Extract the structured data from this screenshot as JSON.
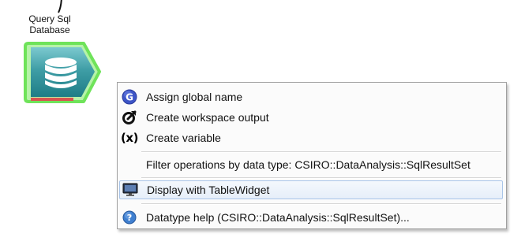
{
  "canvas": {
    "node": {
      "label_line1": "Query Sql",
      "label_line2": "Database",
      "icon": "database-icon",
      "border_color": "#7ee86a",
      "fill_color": "#2f8f97",
      "status_bar_color": "#d9534f"
    }
  },
  "context_menu": {
    "items": [
      {
        "label": "Assign global name",
        "icon": "global-name-icon"
      },
      {
        "label": "Create workspace output",
        "icon": "workspace-output-icon"
      },
      {
        "label": "Create variable",
        "icon": "variable-icon"
      },
      {
        "label": "Filter operations by data type: CSIRO::DataAnalysis::SqlResultSet",
        "icon": ""
      },
      {
        "label": "Display with TableWidget",
        "icon": "monitor-icon"
      },
      {
        "label": "Datatype help (CSIRO::DataAnalysis::SqlResultSet)...",
        "icon": "help-icon"
      }
    ]
  }
}
